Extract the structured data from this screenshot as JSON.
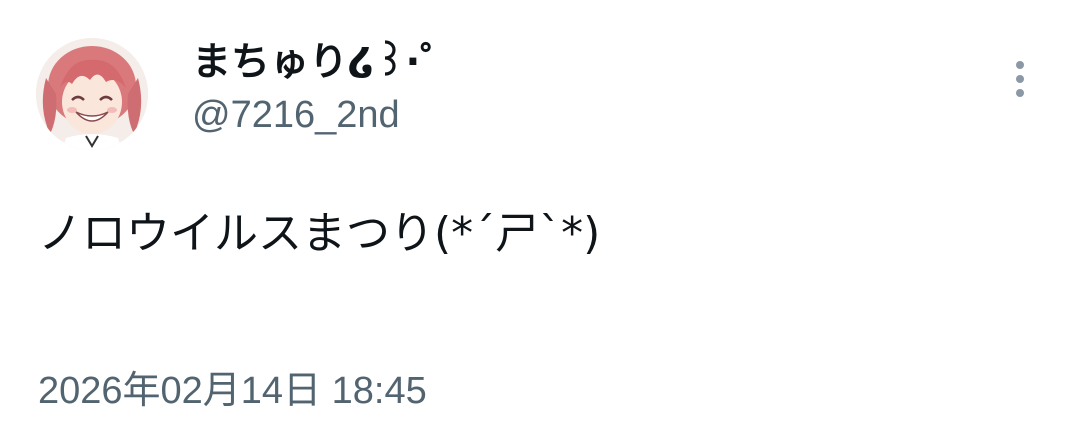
{
  "tweet": {
    "author": {
      "display_name": "まちゅり໒꒱·゜",
      "handle": "@7216_2nd",
      "avatar_icon": "avatar-image"
    },
    "more_icon": "more-options-icon",
    "text": "ノロウイルスまつり(*´ㄕ`*)",
    "timestamp": "2026年02月14日 18:45"
  },
  "colors": {
    "text_primary": "#0f1419",
    "text_secondary": "#536471",
    "icon_gray": "#8b98a5",
    "background": "#ffffff"
  }
}
